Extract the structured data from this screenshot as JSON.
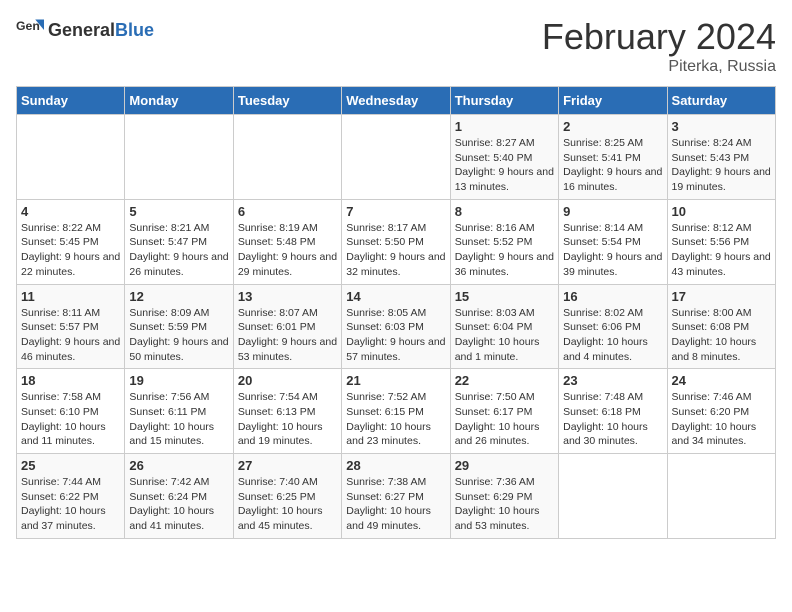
{
  "header": {
    "logo_general": "General",
    "logo_blue": "Blue",
    "month_title": "February 2024",
    "subtitle": "Piterka, Russia"
  },
  "columns": [
    "Sunday",
    "Monday",
    "Tuesday",
    "Wednesday",
    "Thursday",
    "Friday",
    "Saturday"
  ],
  "weeks": [
    [
      {
        "day": "",
        "detail": ""
      },
      {
        "day": "",
        "detail": ""
      },
      {
        "day": "",
        "detail": ""
      },
      {
        "day": "",
        "detail": ""
      },
      {
        "day": "1",
        "detail": "Sunrise: 8:27 AM\nSunset: 5:40 PM\nDaylight: 9 hours\nand 13 minutes."
      },
      {
        "day": "2",
        "detail": "Sunrise: 8:25 AM\nSunset: 5:41 PM\nDaylight: 9 hours\nand 16 minutes."
      },
      {
        "day": "3",
        "detail": "Sunrise: 8:24 AM\nSunset: 5:43 PM\nDaylight: 9 hours\nand 19 minutes."
      }
    ],
    [
      {
        "day": "4",
        "detail": "Sunrise: 8:22 AM\nSunset: 5:45 PM\nDaylight: 9 hours\nand 22 minutes."
      },
      {
        "day": "5",
        "detail": "Sunrise: 8:21 AM\nSunset: 5:47 PM\nDaylight: 9 hours\nand 26 minutes."
      },
      {
        "day": "6",
        "detail": "Sunrise: 8:19 AM\nSunset: 5:48 PM\nDaylight: 9 hours\nand 29 minutes."
      },
      {
        "day": "7",
        "detail": "Sunrise: 8:17 AM\nSunset: 5:50 PM\nDaylight: 9 hours\nand 32 minutes."
      },
      {
        "day": "8",
        "detail": "Sunrise: 8:16 AM\nSunset: 5:52 PM\nDaylight: 9 hours\nand 36 minutes."
      },
      {
        "day": "9",
        "detail": "Sunrise: 8:14 AM\nSunset: 5:54 PM\nDaylight: 9 hours\nand 39 minutes."
      },
      {
        "day": "10",
        "detail": "Sunrise: 8:12 AM\nSunset: 5:56 PM\nDaylight: 9 hours\nand 43 minutes."
      }
    ],
    [
      {
        "day": "11",
        "detail": "Sunrise: 8:11 AM\nSunset: 5:57 PM\nDaylight: 9 hours\nand 46 minutes."
      },
      {
        "day": "12",
        "detail": "Sunrise: 8:09 AM\nSunset: 5:59 PM\nDaylight: 9 hours\nand 50 minutes."
      },
      {
        "day": "13",
        "detail": "Sunrise: 8:07 AM\nSunset: 6:01 PM\nDaylight: 9 hours\nand 53 minutes."
      },
      {
        "day": "14",
        "detail": "Sunrise: 8:05 AM\nSunset: 6:03 PM\nDaylight: 9 hours\nand 57 minutes."
      },
      {
        "day": "15",
        "detail": "Sunrise: 8:03 AM\nSunset: 6:04 PM\nDaylight: 10 hours\nand 1 minute."
      },
      {
        "day": "16",
        "detail": "Sunrise: 8:02 AM\nSunset: 6:06 PM\nDaylight: 10 hours\nand 4 minutes."
      },
      {
        "day": "17",
        "detail": "Sunrise: 8:00 AM\nSunset: 6:08 PM\nDaylight: 10 hours\nand 8 minutes."
      }
    ],
    [
      {
        "day": "18",
        "detail": "Sunrise: 7:58 AM\nSunset: 6:10 PM\nDaylight: 10 hours\nand 11 minutes."
      },
      {
        "day": "19",
        "detail": "Sunrise: 7:56 AM\nSunset: 6:11 PM\nDaylight: 10 hours\nand 15 minutes."
      },
      {
        "day": "20",
        "detail": "Sunrise: 7:54 AM\nSunset: 6:13 PM\nDaylight: 10 hours\nand 19 minutes."
      },
      {
        "day": "21",
        "detail": "Sunrise: 7:52 AM\nSunset: 6:15 PM\nDaylight: 10 hours\nand 23 minutes."
      },
      {
        "day": "22",
        "detail": "Sunrise: 7:50 AM\nSunset: 6:17 PM\nDaylight: 10 hours\nand 26 minutes."
      },
      {
        "day": "23",
        "detail": "Sunrise: 7:48 AM\nSunset: 6:18 PM\nDaylight: 10 hours\nand 30 minutes."
      },
      {
        "day": "24",
        "detail": "Sunrise: 7:46 AM\nSunset: 6:20 PM\nDaylight: 10 hours\nand 34 minutes."
      }
    ],
    [
      {
        "day": "25",
        "detail": "Sunrise: 7:44 AM\nSunset: 6:22 PM\nDaylight: 10 hours\nand 37 minutes."
      },
      {
        "day": "26",
        "detail": "Sunrise: 7:42 AM\nSunset: 6:24 PM\nDaylight: 10 hours\nand 41 minutes."
      },
      {
        "day": "27",
        "detail": "Sunrise: 7:40 AM\nSunset: 6:25 PM\nDaylight: 10 hours\nand 45 minutes."
      },
      {
        "day": "28",
        "detail": "Sunrise: 7:38 AM\nSunset: 6:27 PM\nDaylight: 10 hours\nand 49 minutes."
      },
      {
        "day": "29",
        "detail": "Sunrise: 7:36 AM\nSunset: 6:29 PM\nDaylight: 10 hours\nand 53 minutes."
      },
      {
        "day": "",
        "detail": ""
      },
      {
        "day": "",
        "detail": ""
      }
    ]
  ]
}
